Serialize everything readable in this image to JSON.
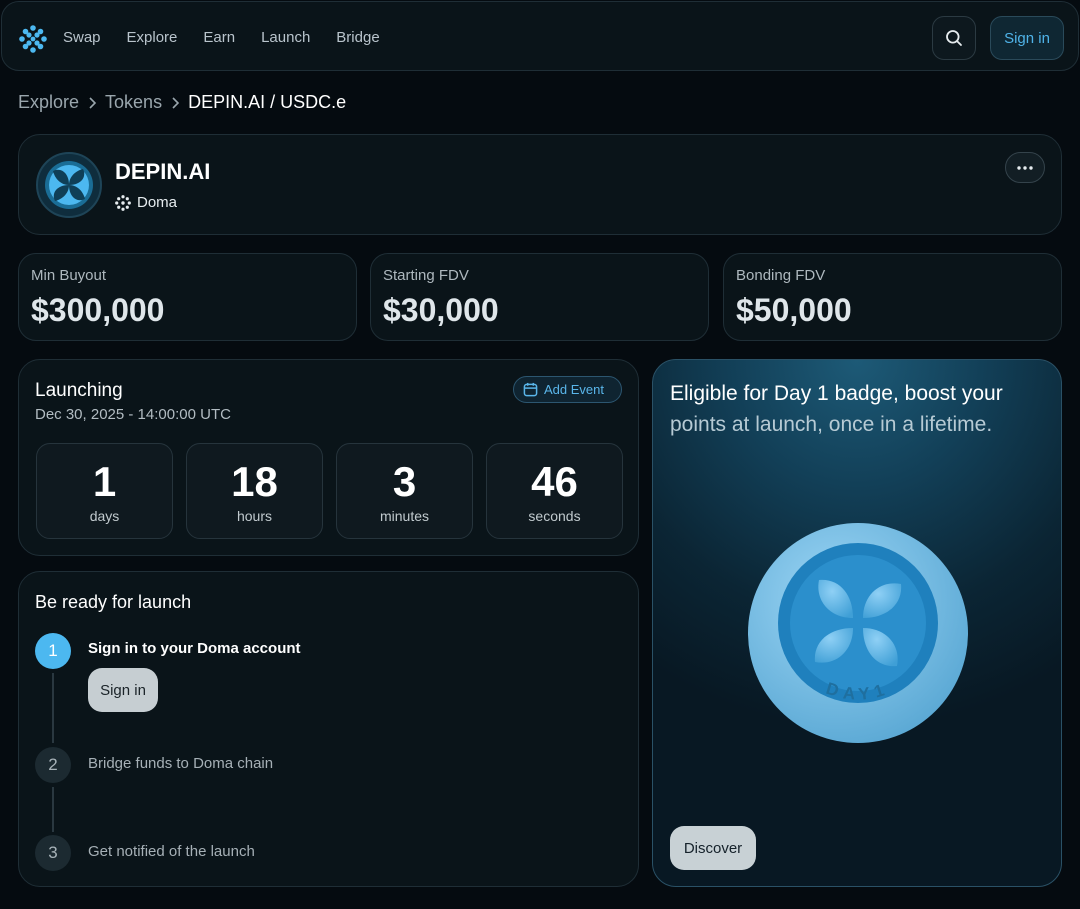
{
  "nav": {
    "logo_icon": "doma-logo-icon",
    "links": [
      "Swap",
      "Explore",
      "Earn",
      "Launch",
      "Bridge"
    ],
    "search_icon": "search-icon",
    "sign_in_label": "Sign in"
  },
  "breadcrumb": {
    "items": [
      "Explore",
      "Tokens",
      "DEPIN.AI / USDC.e"
    ]
  },
  "token": {
    "name": "DEPIN.AI",
    "chain": "Doma",
    "more_icon": "more-horizontal-icon"
  },
  "stats": [
    {
      "label": "Min Buyout",
      "value": "$300,000"
    },
    {
      "label": "Starting FDV",
      "value": "$30,000"
    },
    {
      "label": "Bonding FDV",
      "value": "$50,000"
    }
  ],
  "launch": {
    "title": "Launching",
    "date": "Dec 30, 2025 - 14:00:00 UTC",
    "add_event_label": "Add Event",
    "countdown": [
      {
        "value": "1",
        "unit": "days"
      },
      {
        "value": "18",
        "unit": "hours"
      },
      {
        "value": "3",
        "unit": "minutes"
      },
      {
        "value": "46",
        "unit": "seconds"
      }
    ]
  },
  "steps": {
    "title": "Be ready for launch",
    "items": [
      {
        "number": "1",
        "label": "Sign in to your Doma account",
        "button": "Sign in"
      },
      {
        "number": "2",
        "label": "Bridge funds to Doma chain"
      },
      {
        "number": "3",
        "label": "Get notified of the launch"
      }
    ]
  },
  "badge": {
    "text_highlight": "Eligible for Day 1 badge, boost your",
    "text_rest": "points at launch, once in a lifetime.",
    "badge_label": "DAY1",
    "discover_label": "Discover"
  },
  "colors": {
    "accent": "#4cb8f0",
    "background": "#050b10",
    "panel": "#0a1419"
  }
}
